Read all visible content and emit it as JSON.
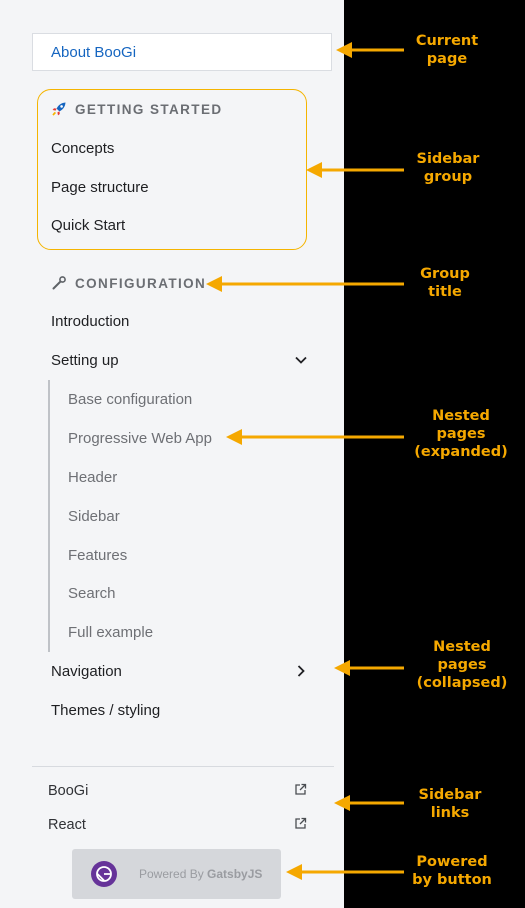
{
  "current_page": {
    "label": "About BooGi"
  },
  "getting_started": {
    "title": "GETTING STARTED",
    "icon": "rocket-icon",
    "items": [
      "Concepts",
      "Page structure",
      "Quick Start"
    ]
  },
  "configuration": {
    "title": "CONFIGURATION",
    "icon": "wrench-icon",
    "items": {
      "introduction": "Introduction",
      "setting_up": "Setting up",
      "setting_up_children": [
        "Base configuration",
        "Progressive Web App",
        "Header",
        "Sidebar",
        "Features",
        "Search",
        "Full example"
      ],
      "navigation": "Navigation",
      "themes": "Themes / styling"
    }
  },
  "links": [
    "BooGi",
    "React"
  ],
  "powered": {
    "prefix": "Powered By",
    "brand": "GatsbyJS"
  },
  "callouts": [
    [
      "Current",
      "page"
    ],
    [
      "Sidebar",
      "group"
    ],
    [
      "Group",
      "title"
    ],
    [
      "Nested",
      "pages",
      "(expanded)"
    ],
    [
      "Nested",
      "pages",
      "(collapsed)"
    ],
    [
      "Sidebar",
      "links"
    ],
    [
      "Powered",
      "by button"
    ]
  ],
  "colors": {
    "accent": "#f5a800",
    "link": "#1565c0",
    "gatsby": "#663399"
  }
}
